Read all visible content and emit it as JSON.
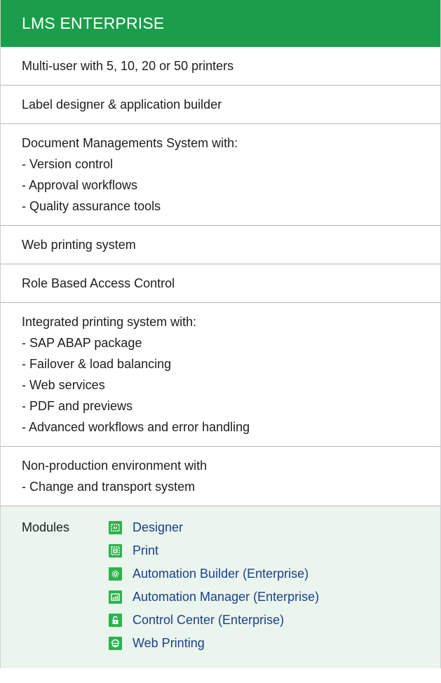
{
  "header": {
    "title": "LMS ENTERPRISE"
  },
  "sections": [
    {
      "lines": [
        "Multi-user with 5, 10, 20 or 50 printers"
      ]
    },
    {
      "lines": [
        "Label designer & application builder"
      ]
    },
    {
      "lines": [
        "Document Managements System with:",
        "- Version control",
        "- Approval workflows",
        "- Quality assurance tools"
      ]
    },
    {
      "lines": [
        "Web printing system"
      ]
    },
    {
      "lines": [
        "Role Based Access Control"
      ]
    },
    {
      "lines": [
        "Integrated printing system with:",
        "- SAP ABAP package",
        "- Failover & load balancing",
        "- Web services",
        "- PDF and previews",
        "- Advanced workflows and error handling"
      ]
    },
    {
      "lines": [
        "Non-production environment with",
        "- Change and transport system"
      ]
    }
  ],
  "modules": {
    "label": "Modules",
    "items": [
      {
        "label": "Designer",
        "icon": "designer-icon"
      },
      {
        "label": "Print",
        "icon": "print-icon"
      },
      {
        "label": "Automation Builder (Enterprise)",
        "icon": "gear-icon"
      },
      {
        "label": "Automation Manager (Enterprise)",
        "icon": "dashboard-icon"
      },
      {
        "label": "Control Center (Enterprise)",
        "icon": "lock-icon"
      },
      {
        "label": "Web Printing",
        "icon": "web-printer-icon"
      }
    ]
  },
  "colors": {
    "header_bg": "#1a9e4c",
    "modules_bg": "#e9f5ed",
    "link": "#1d3f8a",
    "icon_bg": "#2fb24d"
  }
}
